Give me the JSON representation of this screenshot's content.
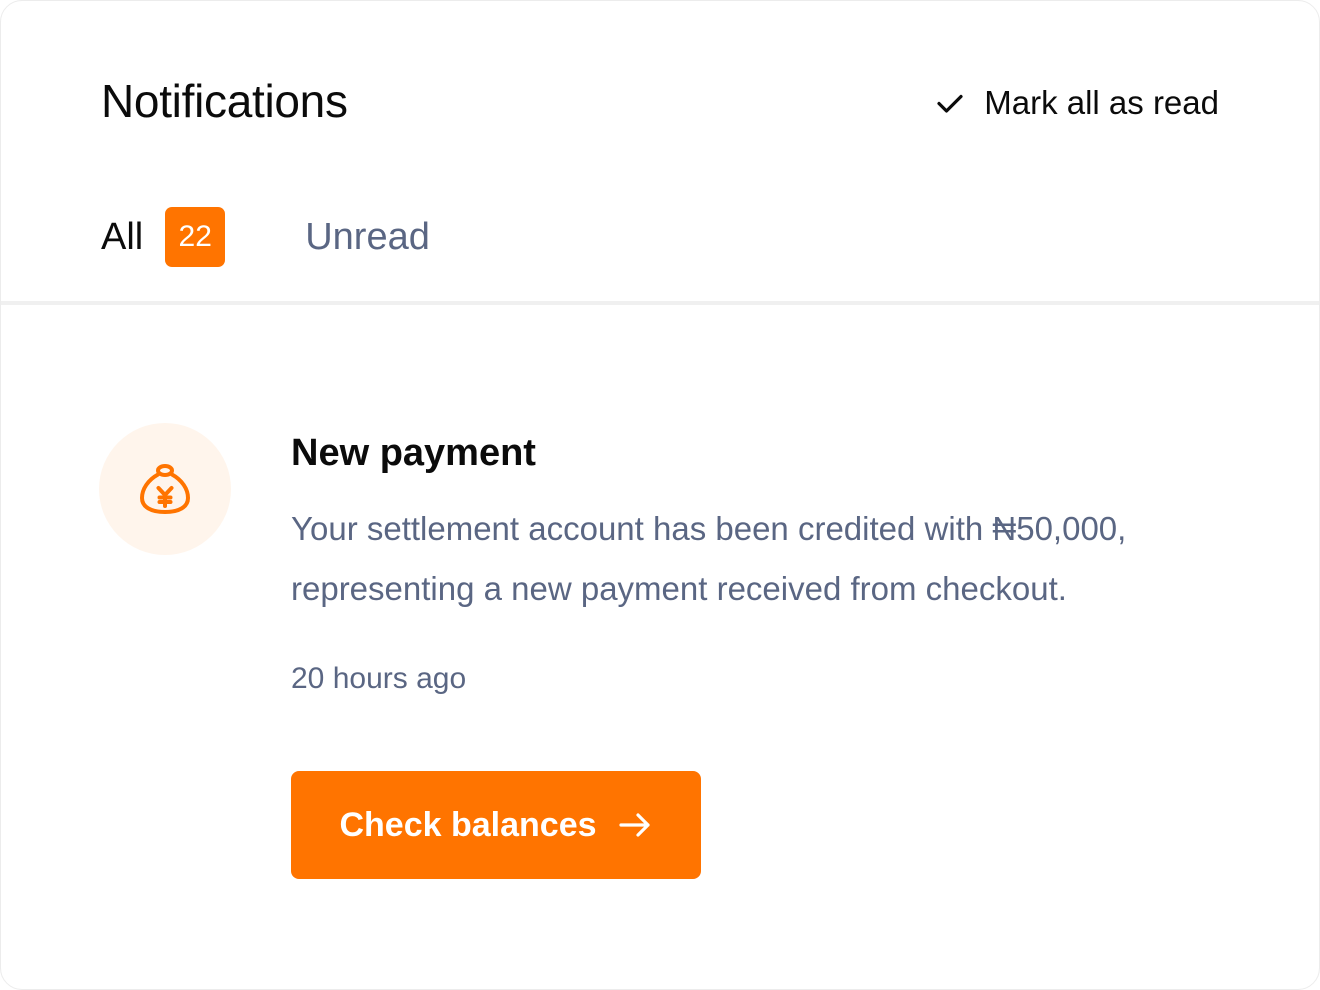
{
  "header": {
    "title": "Notifications",
    "mark_all_label": "Mark all as read"
  },
  "tabs": [
    {
      "label": "All",
      "count": "22",
      "active": true
    },
    {
      "label": "Unread",
      "active": false
    }
  ],
  "notification": {
    "icon": "money-bag-yen-icon",
    "title": "New payment",
    "body": "Your settlement account has been credited with ₦50,000, representing a new payment received from checkout.",
    "time": "20 hours ago",
    "action_label": "Check balances"
  },
  "colors": {
    "accent": "#ff7400",
    "text_primary": "#0b0b0b",
    "text_secondary": "#5a6683",
    "icon_bg": "#fff5ec"
  }
}
